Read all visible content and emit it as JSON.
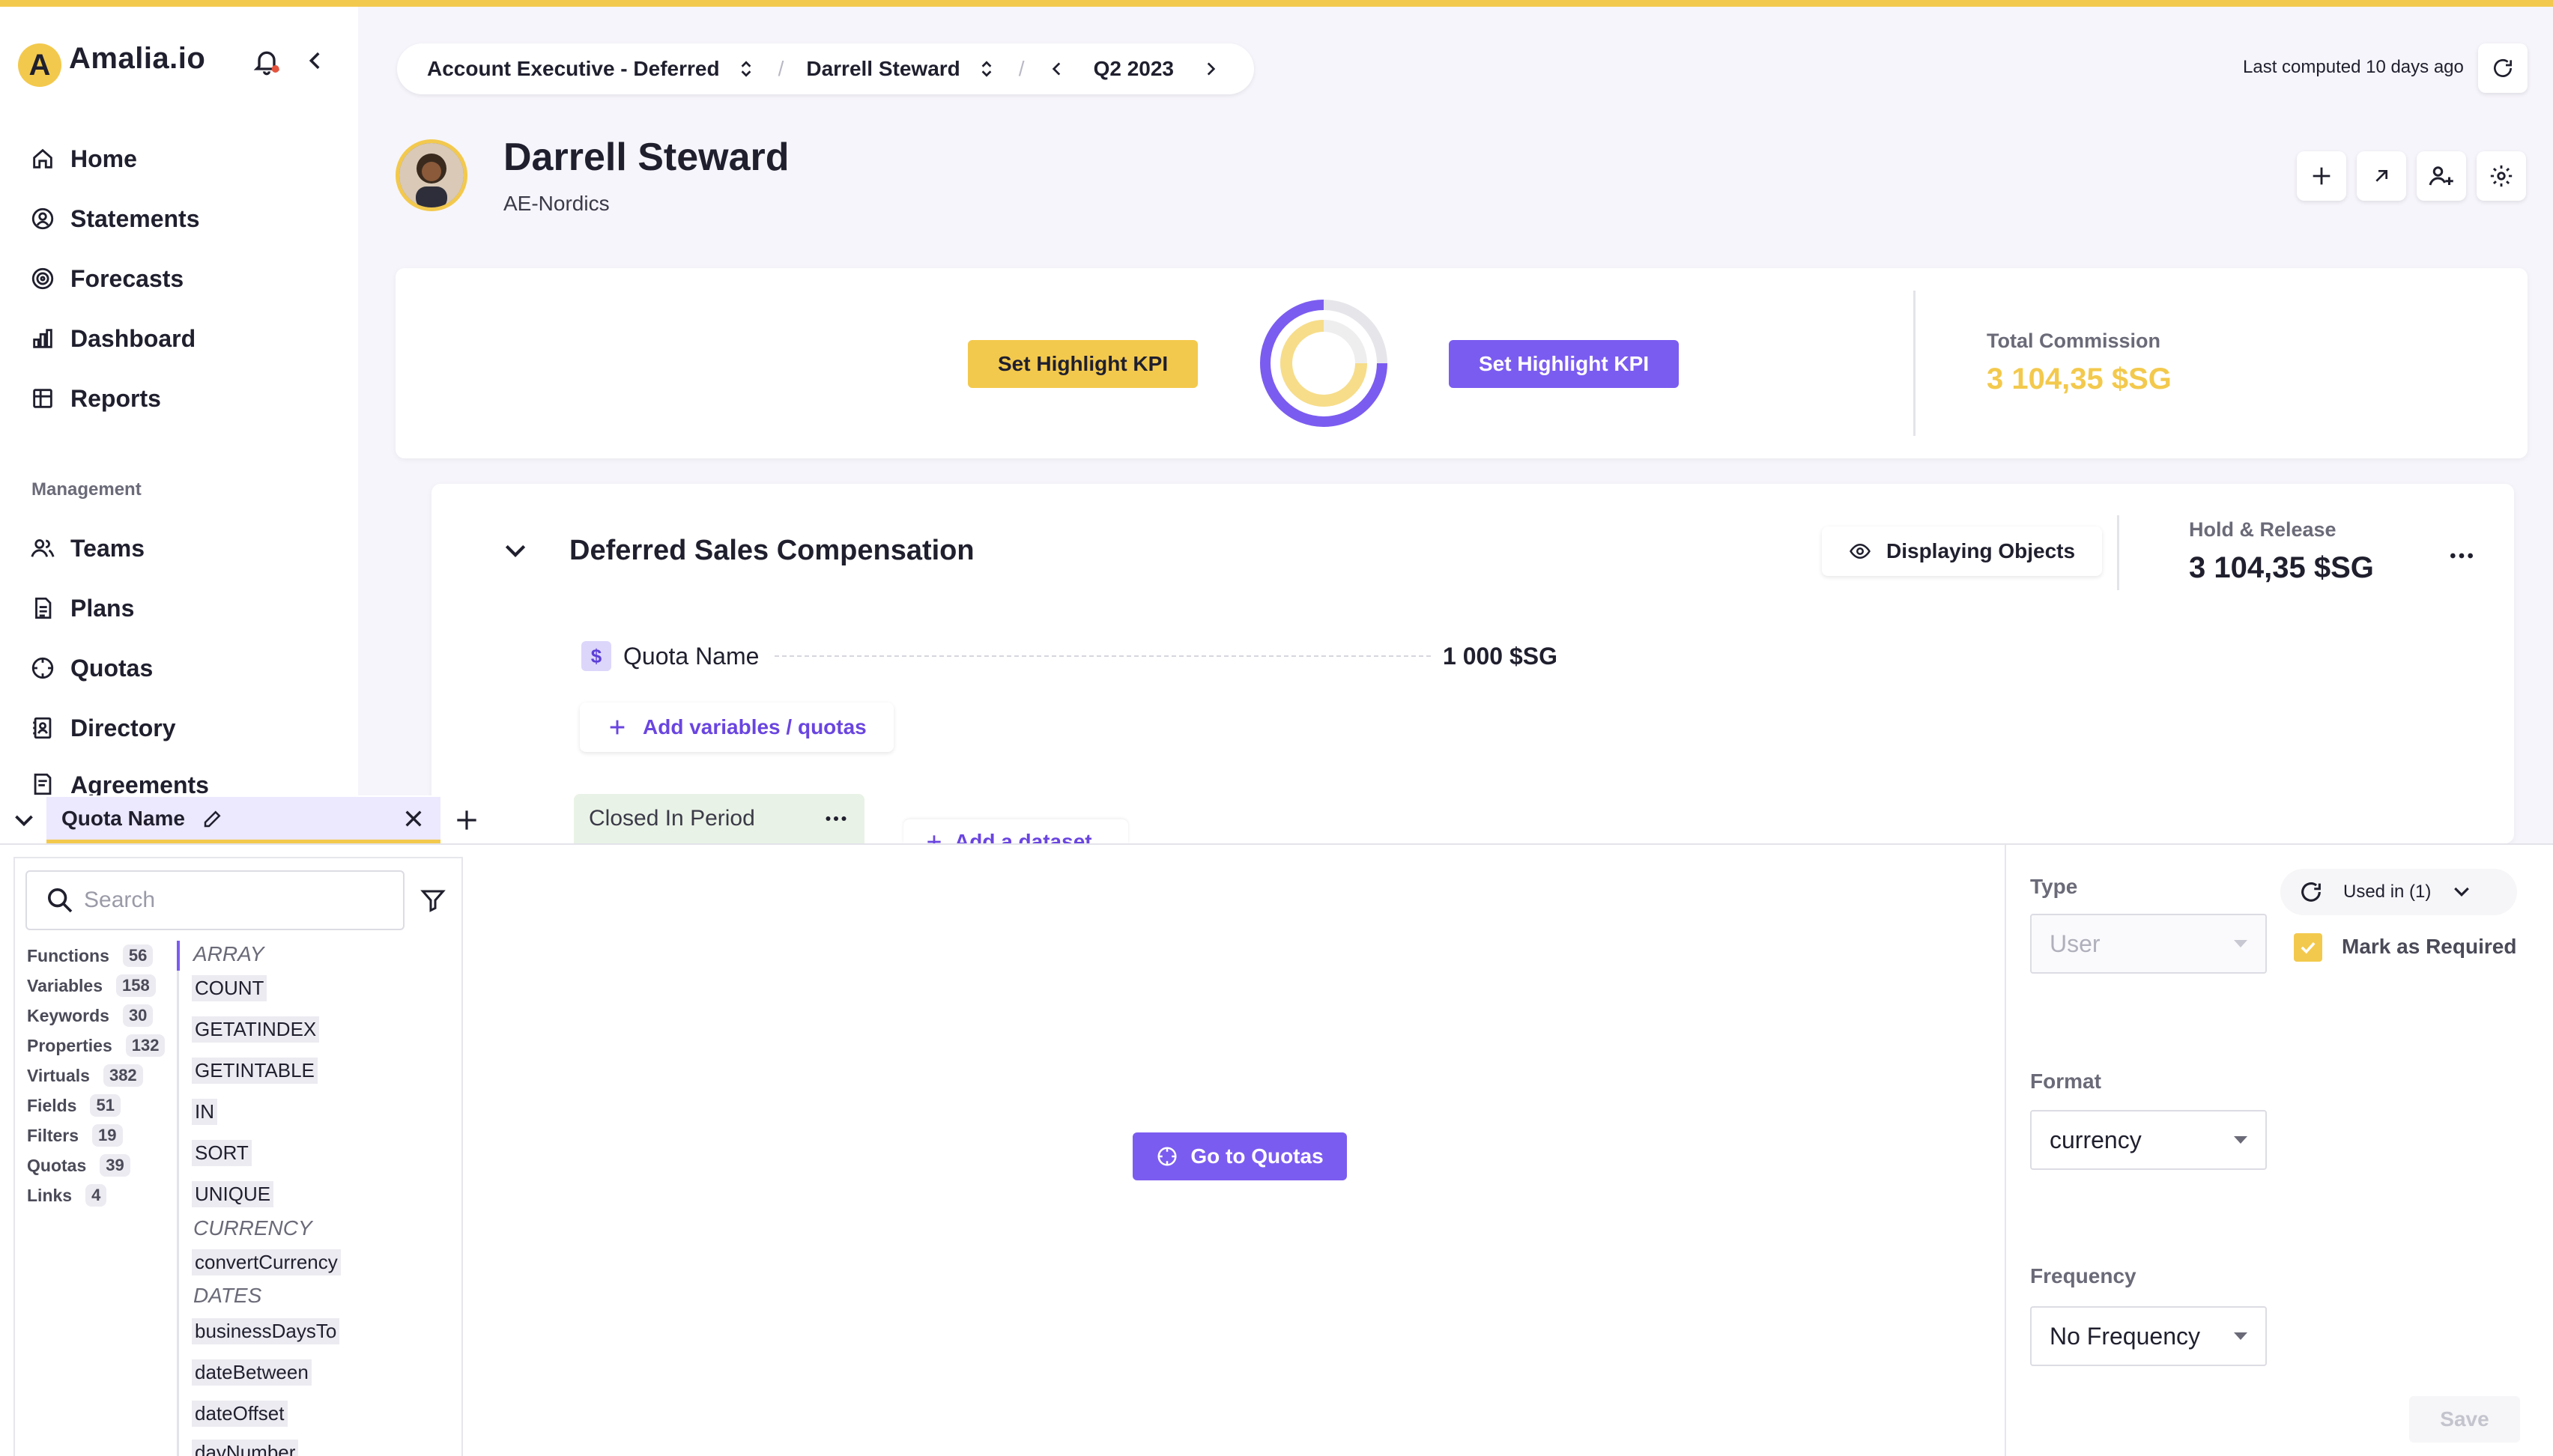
{
  "app": {
    "logo_letter": "A",
    "name": "Amalia.io"
  },
  "sidebar": {
    "items": [
      {
        "label": "Home",
        "icon": "home-icon"
      },
      {
        "label": "Statements",
        "icon": "statements-icon"
      },
      {
        "label": "Forecasts",
        "icon": "forecasts-icon"
      },
      {
        "label": "Dashboard",
        "icon": "dashboard-icon"
      },
      {
        "label": "Reports",
        "icon": "reports-icon"
      }
    ],
    "management_label": "Management",
    "management_items": [
      {
        "label": "Teams",
        "icon": "teams-icon"
      },
      {
        "label": "Plans",
        "icon": "plans-icon"
      },
      {
        "label": "Quotas",
        "icon": "quotas-icon"
      },
      {
        "label": "Directory",
        "icon": "directory-icon"
      },
      {
        "label": "Agreements",
        "icon": "agreements-icon"
      }
    ]
  },
  "breadcrumb": {
    "plan": "Account Executive - Deferred",
    "user": "Darrell Steward",
    "period": "Q2 2023"
  },
  "last_computed": "Last computed 10 days ago",
  "header": {
    "name": "Darrell Steward",
    "team": "AE-Nordics"
  },
  "kpi": {
    "left_button": "Set Highlight KPI",
    "right_button": "Set Highlight KPI",
    "total_label": "Total Commission",
    "total_value": "3 104,35 $SG",
    "colors": {
      "yellow": "#f3c94d",
      "purple": "#7b5cf0"
    }
  },
  "plan": {
    "title": "Deferred Sales Compensation",
    "display_button": "Displaying Objects",
    "hold_label": "Hold & Release",
    "hold_value": "3 104,35 $SG",
    "variable_icon": "$",
    "variable_name": "Quota Name",
    "variable_value": "1 000 $SG",
    "add_variables": "Add variables / quotas",
    "dataset_label": "Closed In Period",
    "add_dataset": "Add a dataset"
  },
  "editor": {
    "tab_label": "Quota Name",
    "search_placeholder": "Search",
    "categories": [
      {
        "label": "Functions",
        "count": "56"
      },
      {
        "label": "Variables",
        "count": "158"
      },
      {
        "label": "Keywords",
        "count": "30"
      },
      {
        "label": "Properties",
        "count": "132"
      },
      {
        "label": "Virtuals",
        "count": "382"
      },
      {
        "label": "Fields",
        "count": "51"
      },
      {
        "label": "Filters",
        "count": "19"
      },
      {
        "label": "Quotas",
        "count": "39"
      },
      {
        "label": "Links",
        "count": "4"
      }
    ],
    "functions": [
      {
        "group": "ARRAY"
      },
      {
        "item": "COUNT"
      },
      {
        "item": "GETATINDEX"
      },
      {
        "item": "GETINTABLE"
      },
      {
        "item": "IN"
      },
      {
        "item": "SORT"
      },
      {
        "item": "UNIQUE"
      },
      {
        "group": "CURRENCY"
      },
      {
        "item": "convertCurrency"
      },
      {
        "group": "DATES"
      },
      {
        "item": "businessDaysTo"
      },
      {
        "item": "dateBetween"
      },
      {
        "item": "dateOffset"
      },
      {
        "item": "dayNumber"
      }
    ],
    "goto_button": "Go to Quotas",
    "type_label": "Type",
    "type_value": "User",
    "used_in": "Used in (1)",
    "mark_required": "Mark as Required",
    "format_label": "Format",
    "format_value": "currency",
    "frequency_label": "Frequency",
    "frequency_value": "No Frequency",
    "save_label": "Save"
  }
}
